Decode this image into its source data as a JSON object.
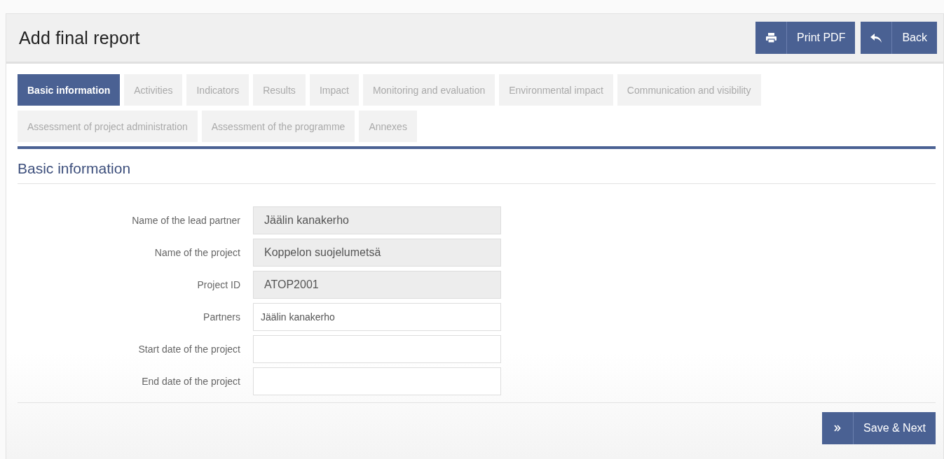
{
  "page_title": "Add final report",
  "header_buttons": [
    {
      "kind": "print",
      "label": "Print PDF"
    },
    {
      "kind": "back",
      "label": "Back"
    }
  ],
  "tabs": [
    {
      "label": "Basic information",
      "selected": true
    },
    {
      "label": "Activities",
      "selected": false
    },
    {
      "label": "Indicators",
      "selected": false
    },
    {
      "label": "Results",
      "selected": false
    },
    {
      "label": "Impact",
      "selected": false
    },
    {
      "label": "Monitoring and evaluation",
      "selected": false
    },
    {
      "label": "Environmental impact",
      "selected": false
    },
    {
      "label": "Communication and visibility",
      "selected": false
    },
    {
      "label": "Assessment of project administration",
      "selected": false
    },
    {
      "label": "Assessment of the programme",
      "selected": false
    },
    {
      "label": "Annexes",
      "selected": false
    }
  ],
  "section_title": "Basic information",
  "fields": [
    {
      "label": "Name of the lead partner",
      "value": "Jäälin kanakerho",
      "readonly": true
    },
    {
      "label": "Name of the project",
      "value": "Koppelon suojelumetsä",
      "readonly": true
    },
    {
      "label": "Project ID",
      "value": "ATOP2001",
      "readonly": true
    },
    {
      "label": "Partners",
      "value": "Jäälin kanakerho",
      "readonly": false
    },
    {
      "label": "Start date of the project",
      "readonly": false
    },
    {
      "label": "End date of the project",
      "readonly": false
    }
  ],
  "footer_button": {
    "label": "Save & Next"
  }
}
